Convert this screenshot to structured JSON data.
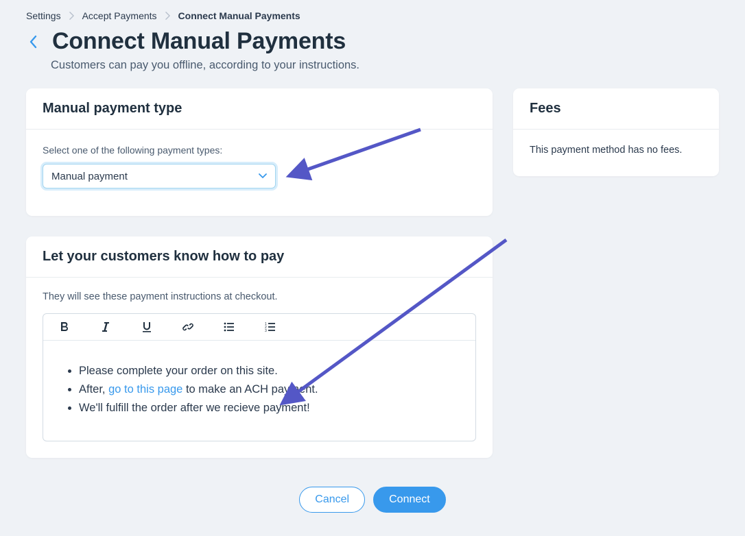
{
  "breadcrumb": {
    "items": [
      {
        "label": "Settings"
      },
      {
        "label": "Accept Payments"
      },
      {
        "label": "Connect Manual Payments"
      }
    ]
  },
  "header": {
    "title": "Connect Manual Payments",
    "subtitle": "Customers can pay you offline, according to your instructions."
  },
  "payment_type": {
    "card_title": "Manual payment type",
    "label": "Select one of the following payment types:",
    "selected": "Manual payment"
  },
  "fees": {
    "card_title": "Fees",
    "text": "This payment method has no fees."
  },
  "instructions": {
    "card_title": "Let your customers know how to pay",
    "caption": "They will see these payment instructions at checkout.",
    "bullets": {
      "b1": "Please complete your order on this site.",
      "b2_pre": "After, ",
      "b2_link": "go to this page",
      "b2_post": " to make an ACH payment.",
      "b3": "We'll fulfill the order after we recieve payment!"
    }
  },
  "footer": {
    "cancel": "Cancel",
    "connect": "Connect"
  },
  "colors": {
    "accent": "#3899ec",
    "arrow": "#5457c6"
  }
}
